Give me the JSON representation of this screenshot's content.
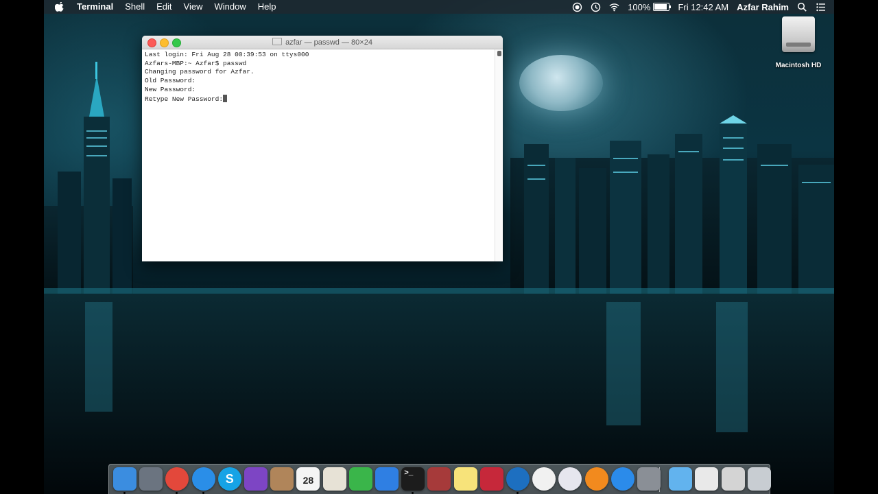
{
  "menubar": {
    "app_name": "Terminal",
    "items": [
      "Shell",
      "Edit",
      "View",
      "Window",
      "Help"
    ],
    "battery_percent": "100%",
    "clock": "Fri 12:42 AM",
    "user": "Azfar Rahim"
  },
  "desktop": {
    "hd_label": "Macintosh HD"
  },
  "terminal": {
    "title": "azfar — passwd — 80×24",
    "lines": [
      "Last login: Fri Aug 28 00:39:53 on ttys000",
      "Azfars-MBP:~ Azfar$ passwd",
      "Changing password for Azfar.",
      "Old Password:",
      "New Password:",
      "Retype New Password:"
    ]
  },
  "dock": {
    "apps": [
      {
        "name": "finder",
        "color": "#3b8de0"
      },
      {
        "name": "launchpad",
        "color": "#6b7480"
      },
      {
        "name": "chrome",
        "color": "#e3483b"
      },
      {
        "name": "safari",
        "color": "#2a8ee8"
      },
      {
        "name": "skype",
        "color": "#16a3e6"
      },
      {
        "name": "imovie",
        "color": "#7d45c4"
      },
      {
        "name": "cleaner",
        "color": "#b0855a"
      },
      {
        "name": "calendar",
        "color": "#f4f4f4"
      },
      {
        "name": "preview",
        "color": "#e7e2d6"
      },
      {
        "name": "numbers",
        "color": "#3ab54a"
      },
      {
        "name": "keynote",
        "color": "#2f7fe3"
      },
      {
        "name": "terminal",
        "color": "#1c1c1c"
      },
      {
        "name": "dictionary",
        "color": "#a63a3a"
      },
      {
        "name": "notes",
        "color": "#f7e37a"
      },
      {
        "name": "photo-booth",
        "color": "#c6283a"
      },
      {
        "name": "edge",
        "color": "#1d6fc0"
      },
      {
        "name": "photos",
        "color": "#f1f1f1"
      },
      {
        "name": "itunes",
        "color": "#e6e6ee"
      },
      {
        "name": "ibooks",
        "color": "#f28a1e"
      },
      {
        "name": "app-store",
        "color": "#2b8bea"
      },
      {
        "name": "system-preferences",
        "color": "#8a8f96"
      },
      {
        "name": "downloads-folder",
        "color": "#62b3ee"
      },
      {
        "name": "documents-stack",
        "color": "#e9e9e9"
      },
      {
        "name": "screen-stack",
        "color": "#d4d4d4"
      },
      {
        "name": "trash",
        "color": "#c8cdd2"
      }
    ],
    "calendar_day": "28"
  }
}
